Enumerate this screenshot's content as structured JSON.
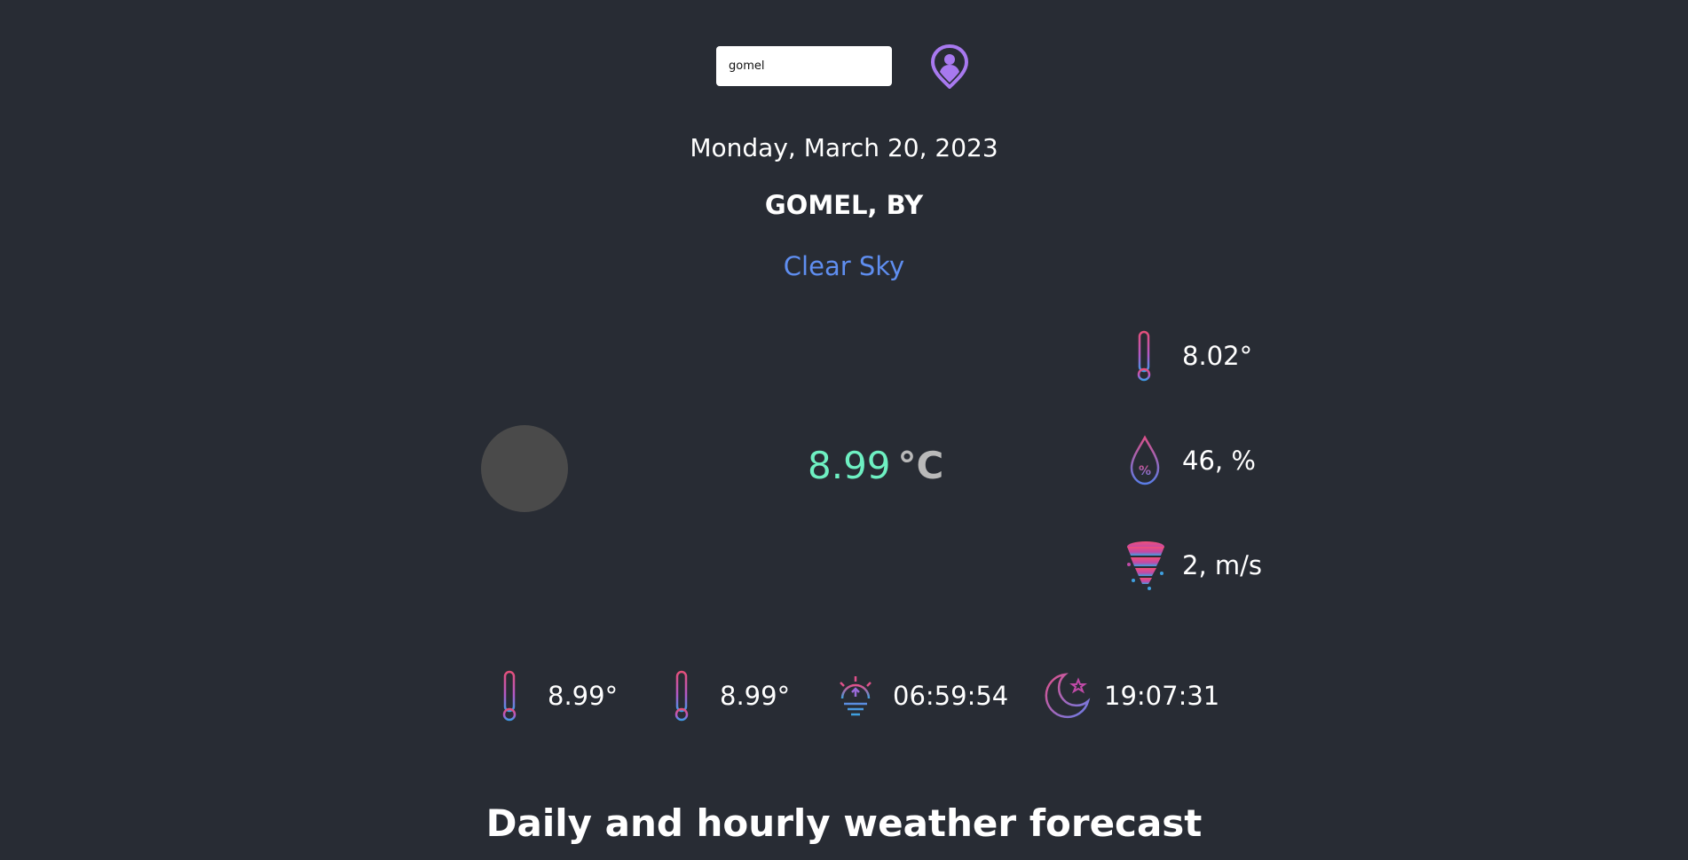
{
  "search": {
    "value": "gomel"
  },
  "date": "Monday, March 20, 2023",
  "city": "GOMEL, BY",
  "condition": "Clear Sky",
  "temperature": {
    "value": "8.99",
    "unit": "°C"
  },
  "details": {
    "feels_like": "8.02°",
    "humidity": "46, %",
    "wind": "2, m/s"
  },
  "bottom": {
    "temp_min": "8.99°",
    "temp_max": "8.99°",
    "sunrise": "06:59:54",
    "sunset": "19:07:31"
  },
  "forecast_heading": "Daily and hourly weather forecast",
  "icons": {
    "location": "location-pin-icon",
    "thermometer": "thermometer-icon",
    "humidity": "water-drop-percent-icon",
    "wind": "tornado-icon",
    "sunrise": "sunrise-icon",
    "sunset": "moon-star-icon",
    "weather": "weather-icon"
  },
  "colors": {
    "background": "#282c34",
    "accent_blue": "#5f8ef0",
    "temperature_green": "#6ef0c2",
    "icon_purple": "#a879ef",
    "icon_pink": "#e44f7a"
  }
}
